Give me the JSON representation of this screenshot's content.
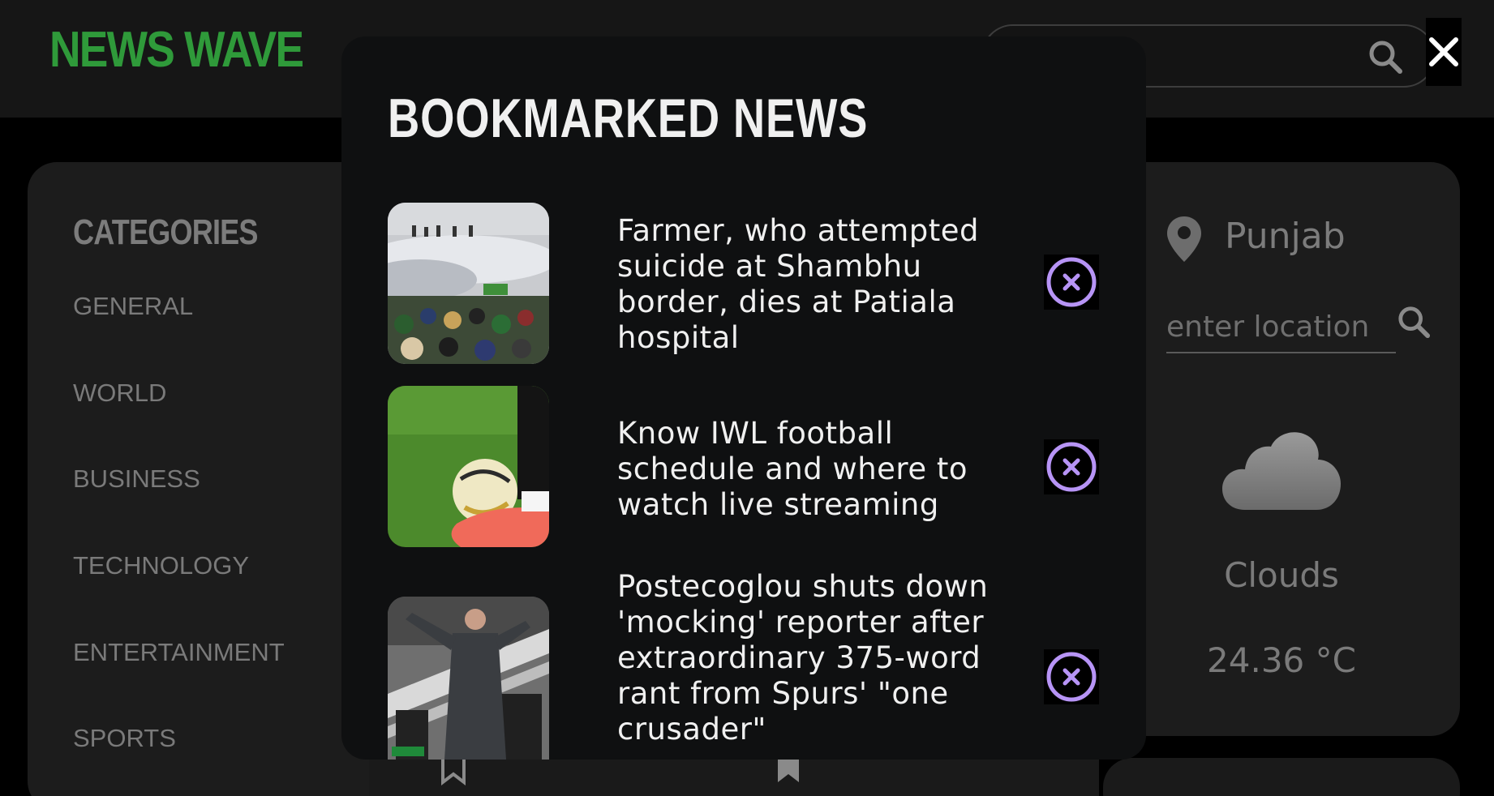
{
  "app": {
    "logo": "NEWS WAVE"
  },
  "header": {
    "search_icon": "search-icon",
    "close_icon": "close-icon"
  },
  "categories": {
    "title": "CATEGORIES",
    "items": [
      "GENERAL",
      "WORLD",
      "BUSINESS",
      "TECHNOLOGY",
      "ENTERTAINMENT",
      "SPORTS"
    ]
  },
  "weather": {
    "location": "Punjab",
    "location_placeholder": "enter location",
    "condition": "Clouds",
    "temperature": "24.36 °C",
    "icons": {
      "pin": "location-pin-icon",
      "cloud": "cloud-icon",
      "search": "search-icon"
    }
  },
  "bookmarks": {
    "title": "BOOKMARKED NEWS",
    "items": [
      {
        "headline": "Farmer, who attempted suicide at Shambhu border, dies at Patiala hospital",
        "image": "protest-tear-gas-photo"
      },
      {
        "headline": "Know IWL football schedule and where to watch live streaming",
        "image": "football-boot-ball-photo"
      },
      {
        "headline": "Postecoglou shuts down 'mocking' reporter after extraordinary 375-word rant from Spurs' \"one crusader\"",
        "image": "coach-gesturing-photo"
      }
    ],
    "remove_icon": "remove-circle-icon",
    "accent_color": "#b794f6"
  },
  "colors": {
    "logo": "#2f9a3a",
    "modal_bg": "#0f1011",
    "page_bg": "#000000"
  }
}
